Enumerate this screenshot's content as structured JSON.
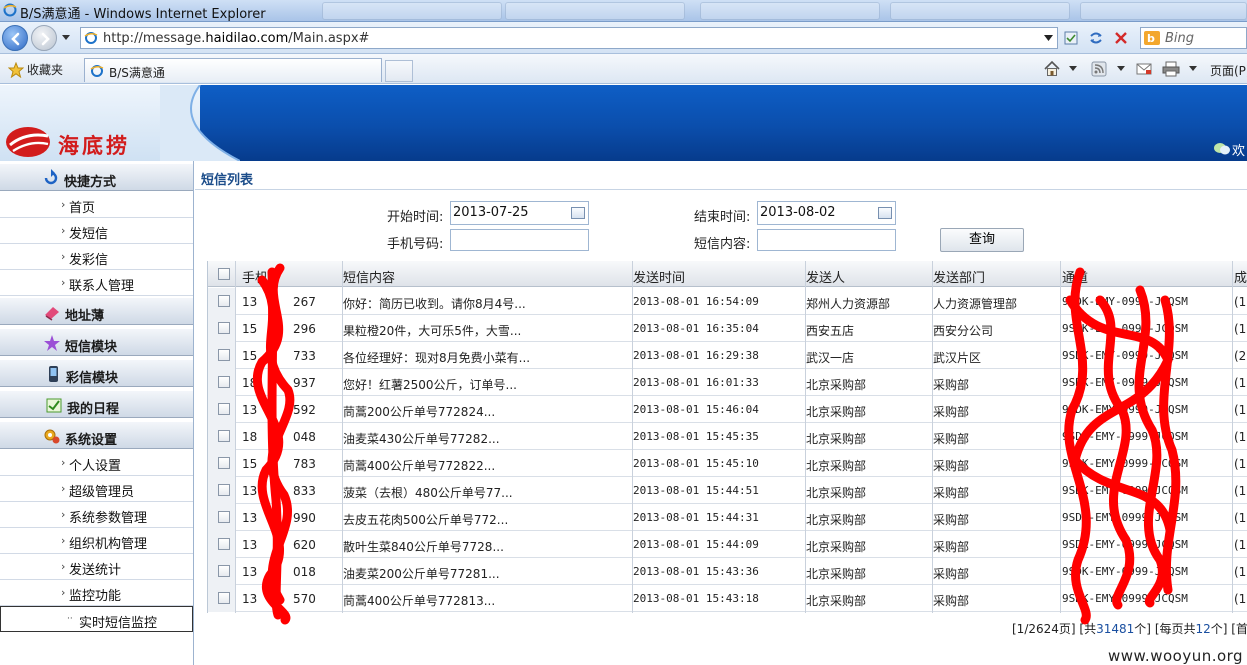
{
  "browser": {
    "window_title": "B/S满意通 - Windows Internet Explorer",
    "url_prefix": "http://message.",
    "url_domain": "haidilao.com",
    "url_suffix": "/Main.aspx#",
    "search_engine": "Bing",
    "favorites_label": "收藏夹",
    "tab_title": "B/S满意通",
    "page_menu": "页面(P)"
  },
  "app": {
    "logo_text": "海底捞",
    "welcome": "欢",
    "accent_color": "#0b4eac",
    "logo_color": "#d21c1c"
  },
  "sidebar": {
    "shortcuts": {
      "title": "快捷方式",
      "items": [
        "首页",
        "发短信",
        "发彩信",
        "联系人管理"
      ]
    },
    "address_book": "地址薄",
    "sms_module": "短信模块",
    "mms_module": "彩信模块",
    "schedule": "我的日程",
    "settings": {
      "title": "系统设置",
      "items": [
        "个人设置",
        "超级管理员",
        "系统参数管理",
        "组织机构管理",
        "发送统计",
        "监控功能"
      ]
    },
    "selected_item": "实时短信监控"
  },
  "main": {
    "title": "短信列表",
    "filters": {
      "start_label": "开始时间:",
      "start_value": "2013-07-25",
      "end_label": "结束时间:",
      "end_value": "2013-08-02",
      "phone_label": "手机号码:",
      "phone_value": "",
      "content_label": "短信内容:",
      "content_value": "",
      "query_button": "查询"
    },
    "table": {
      "headers": [
        "手机号",
        "短信内容",
        "发送时间",
        "发送人",
        "发送部门",
        "通道",
        "成"
      ],
      "rows": [
        {
          "phone": "13",
          "phone_tail": "267",
          "content": "你好：简历已收到。请你8月4号...",
          "time": "2013-08-01 16:54:09",
          "sender": "郑州人力资源部",
          "dept": "人力资源管理部",
          "channel": "9SDK-EMY-0999-JCQSM",
          "status": "(1"
        },
        {
          "phone": "15",
          "phone_tail": "296",
          "content": "果粒橙20件，大可乐5件，大雪...",
          "time": "2013-08-01 16:35:04",
          "sender": "西安五店",
          "dept": "西安分公司",
          "channel": "9SDK-EMY-0999-JCQSM",
          "status": "(1,"
        },
        {
          "phone": "15",
          "phone_tail": "733",
          "content": "各位经理好：现对8月免费小菜有...",
          "time": "2013-08-01 16:29:38",
          "sender": "武汉一店",
          "dept": "武汉片区",
          "channel": "9SDK-EMY-0999-JCQSM",
          "status": "(2,"
        },
        {
          "phone": "18",
          "phone_tail": "937",
          "content": "您好！红薯2500公斤，订单号...",
          "time": "2013-08-01 16:01:33",
          "sender": "北京采购部",
          "dept": "采购部",
          "channel": "9SDK-EMY-0999-JCQSM",
          "status": "(1,"
        },
        {
          "phone": "13",
          "phone_tail": "592",
          "content": "茼蒿200公斤单号772824...",
          "time": "2013-08-01 15:46:04",
          "sender": "北京采购部",
          "dept": "采购部",
          "channel": "9SDK-EMY-0999-JCQSM",
          "status": "(1,"
        },
        {
          "phone": "18",
          "phone_tail": "048",
          "content": "油麦菜430公斤单号77282...",
          "time": "2013-08-01 15:45:35",
          "sender": "北京采购部",
          "dept": "采购部",
          "channel": "9SDK-EMY-0999-JCQSM",
          "status": "(1,"
        },
        {
          "phone": "15",
          "phone_tail": "783",
          "content": "茼蒿400公斤单号772822...",
          "time": "2013-08-01 15:45:10",
          "sender": "北京采购部",
          "dept": "采购部",
          "channel": "9SDK-EMY-0999-JCQSM",
          "status": "(1,"
        },
        {
          "phone": "13",
          "phone_tail": "833",
          "content": "菠菜（去根）480公斤单号77...",
          "time": "2013-08-01 15:44:51",
          "sender": "北京采购部",
          "dept": "采购部",
          "channel": "9SDK-EMY-0999-JCQSM",
          "status": "(1,"
        },
        {
          "phone": "13",
          "phone_tail": "990",
          "content": "去皮五花肉500公斤单号772...",
          "time": "2013-08-01 15:44:31",
          "sender": "北京采购部",
          "dept": "采购部",
          "channel": "9SDK-EMY-0999-JCQSM",
          "status": "(1,"
        },
        {
          "phone": "13",
          "phone_tail": "620",
          "content": "散叶生菜840公斤单号7728...",
          "time": "2013-08-01 15:44:09",
          "sender": "北京采购部",
          "dept": "采购部",
          "channel": "9SDK-EMY-0999-JCQSM",
          "status": "(1,"
        },
        {
          "phone": "13",
          "phone_tail": "018",
          "content": "油麦菜200公斤单号77281...",
          "time": "2013-08-01 15:43:36",
          "sender": "北京采购部",
          "dept": "采购部",
          "channel": "9SDK-EMY-0999-JCQSM",
          "status": "(1,"
        },
        {
          "phone": "13",
          "phone_tail": "570",
          "content": "茼蒿400公斤单号772813...",
          "time": "2013-08-01 15:43:18",
          "sender": "北京采购部",
          "dept": "采购部",
          "channel": "9SDK-EMY-0999-JCQSM",
          "status": "(1,"
        }
      ]
    },
    "pager": {
      "pages": "[1/2624页]",
      "total_prefix": "[共",
      "total": "31481",
      "total_suffix": "个]",
      "per_page_prefix": "[每页共",
      "per_page": "12",
      "per_page_suffix": "个]",
      "first": "[首"
    }
  },
  "watermark": "www.wooyun.org",
  "redaction_color": "#ff0000"
}
